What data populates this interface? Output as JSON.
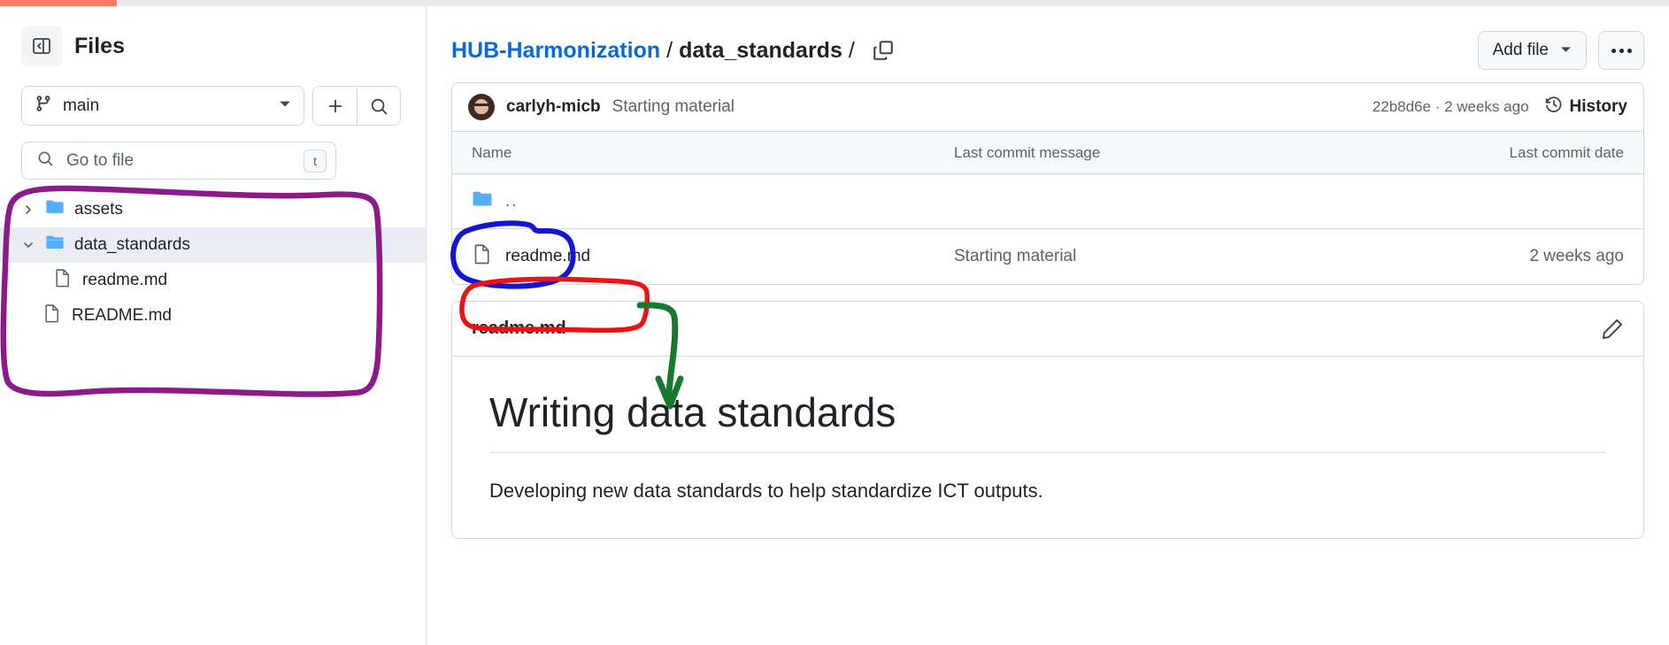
{
  "progress": {
    "percent": 7
  },
  "sidebar": {
    "panel_toggle_icon": "sidebar-collapse-icon",
    "title": "Files",
    "branch": {
      "name": "main",
      "icon": "git-branch-icon",
      "caret_icon": "chevron-down-icon"
    },
    "add_icon": "plus-icon",
    "search_icon": "search-icon",
    "go_to_file": {
      "placeholder": "Go to file",
      "icon": "search-icon",
      "shortcut": "t"
    },
    "tree": [
      {
        "label": "assets",
        "type": "folder",
        "expanded": false,
        "selected": false,
        "depth": 0
      },
      {
        "label": "data_standards",
        "type": "folder",
        "expanded": true,
        "selected": true,
        "depth": 0
      },
      {
        "label": "readme.md",
        "type": "file",
        "selected": false,
        "depth": 1
      },
      {
        "label": "README.md",
        "type": "file",
        "selected": false,
        "depth": 0
      }
    ]
  },
  "header": {
    "breadcrumb": {
      "repo": "HUB-Harmonization",
      "sep1": "/",
      "folder": "data_standards",
      "sep2": "/"
    },
    "copy_icon": "copy-path-icon",
    "add_file_label": "Add file",
    "add_file_caret": "chevron-down-icon",
    "kebab_icon": "more-options-icon"
  },
  "commit_bar": {
    "avatar": "user-avatar",
    "author": "carlyh-micb",
    "message": "Starting material",
    "meta": "22b8d6e · 2 weeks ago",
    "history_label": "History",
    "history_icon": "history-icon"
  },
  "file_table": {
    "columns": {
      "name": "Name",
      "message": "Last commit message",
      "date": "Last commit date"
    },
    "rows": [
      {
        "name": "..",
        "icon": "folder-icon",
        "type": "parent",
        "message": "",
        "date": ""
      },
      {
        "name": "readme.md",
        "icon": "file-icon",
        "type": "file",
        "message": "Starting material",
        "date": "2 weeks ago"
      }
    ]
  },
  "readme": {
    "filename": "readme.md",
    "edit_icon": "pencil-icon",
    "heading": "Writing data standards",
    "paragraph": "Developing new data standards to help standardize ICT outputs."
  },
  "annotations": {
    "tree_circle_color": "#8b1a8b",
    "parent_row_circle_color": "#1414d2",
    "readme_row_circle_color": "#ee1111",
    "arrow_color": "#157a2b"
  },
  "colors": {
    "accent_blue": "#0969da",
    "progress_orange": "#ff7b5f",
    "folder_blue": "#54aeff",
    "border": "#d1d9e0",
    "muted_text": "#59636e"
  }
}
